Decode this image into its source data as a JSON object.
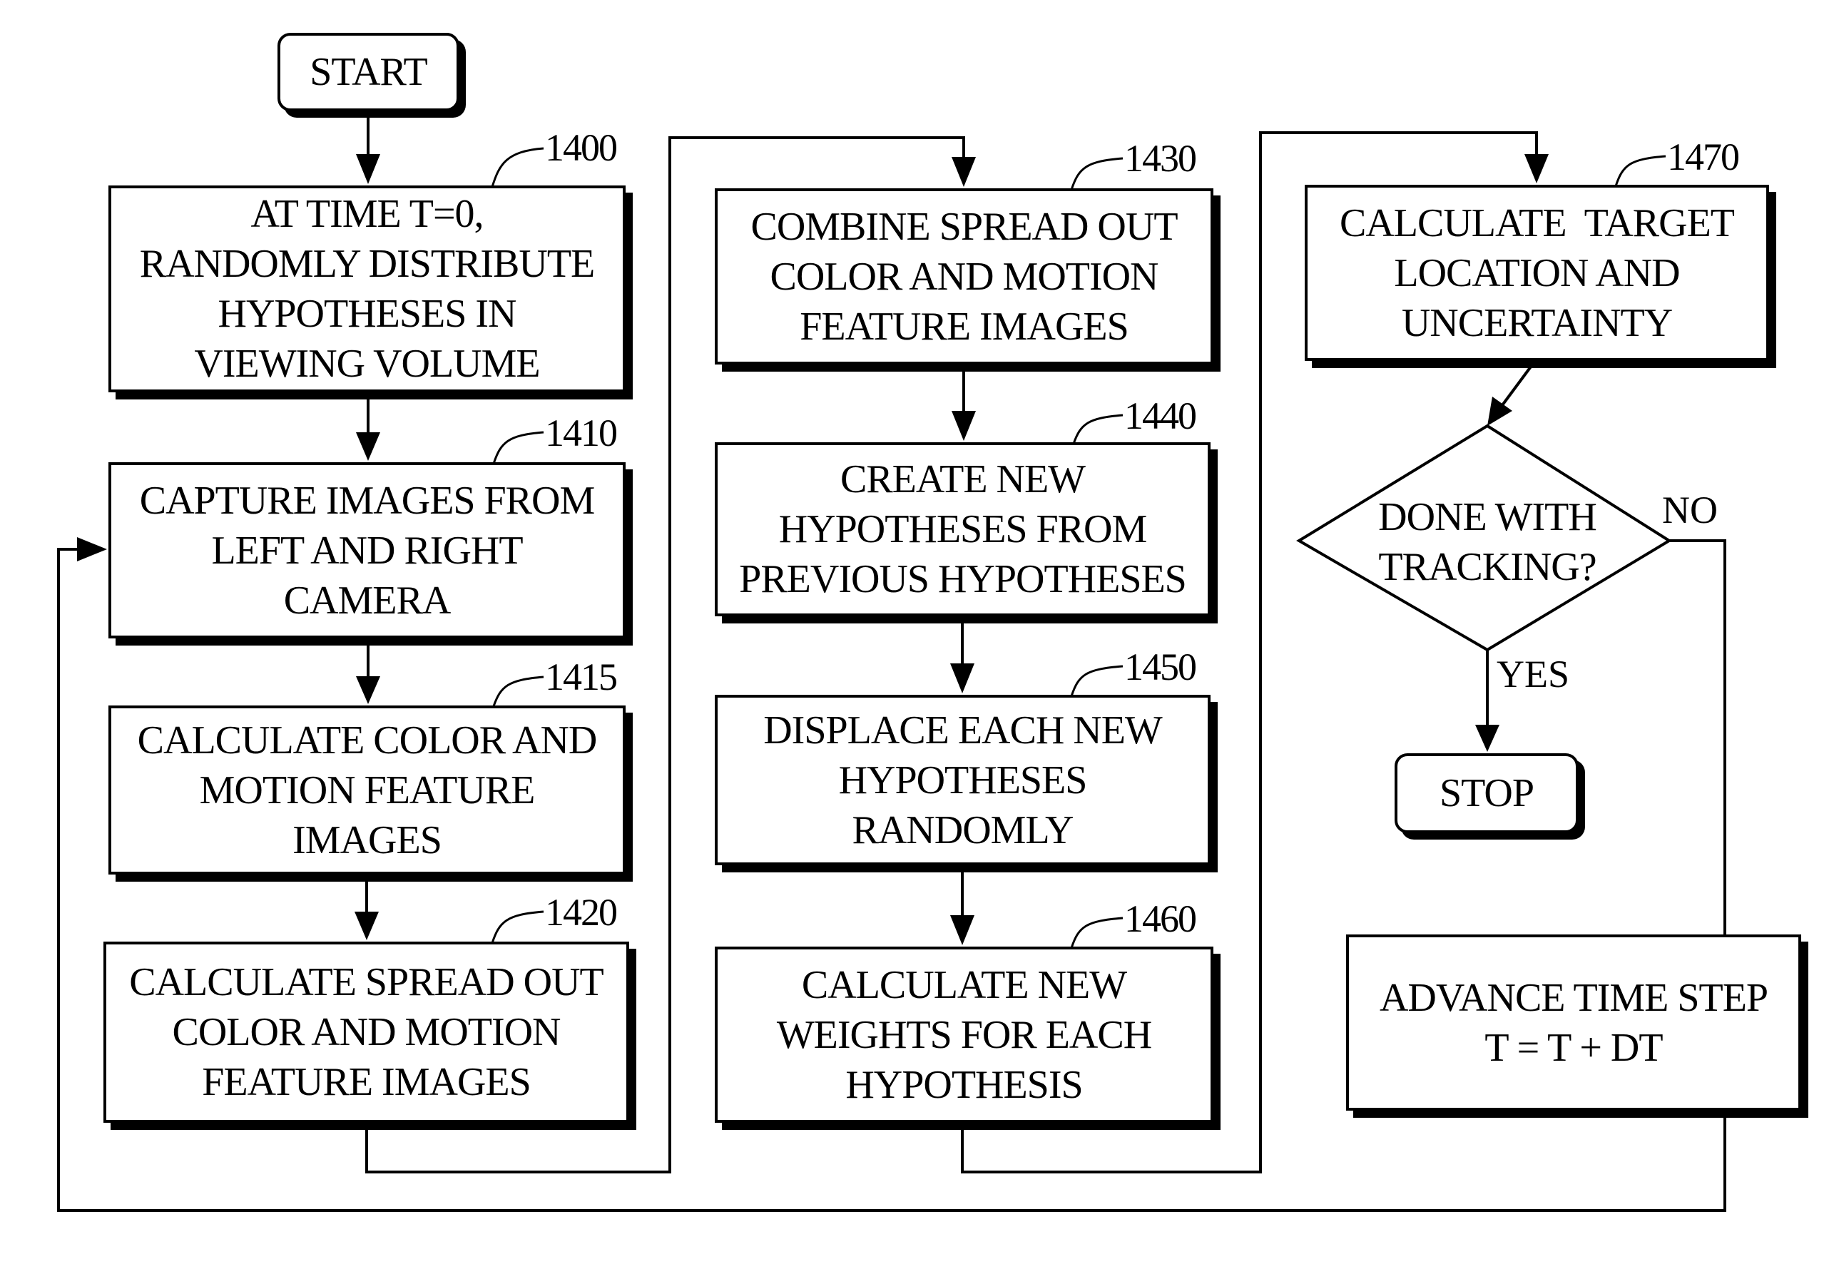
{
  "diagram": {
    "type": "flowchart",
    "start": {
      "label": "START"
    },
    "stop": {
      "label": "STOP"
    },
    "steps": [
      {
        "id": "1400",
        "lines": [
          "AT TIME T=0,",
          "RANDOMLY DISTRIBUTE",
          "HYPOTHESES IN",
          "VIEWING VOLUME"
        ]
      },
      {
        "id": "1410",
        "lines": [
          "CAPTURE IMAGES FROM",
          "LEFT AND RIGHT",
          "CAMERA"
        ]
      },
      {
        "id": "1415",
        "lines": [
          "CALCULATE COLOR AND",
          "MOTION FEATURE",
          "IMAGES"
        ]
      },
      {
        "id": "1420",
        "lines": [
          "CALCULATE SPREAD OUT",
          "COLOR AND MOTION",
          "FEATURE IMAGES"
        ]
      },
      {
        "id": "1430",
        "lines": [
          "COMBINE SPREAD OUT",
          "COLOR AND MOTION",
          "FEATURE IMAGES"
        ]
      },
      {
        "id": "1440",
        "lines": [
          "CREATE NEW",
          "HYPOTHESES FROM",
          "PREVIOUS HYPOTHESES"
        ]
      },
      {
        "id": "1450",
        "lines": [
          "DISPLACE EACH NEW",
          "HYPOTHESES",
          "RANDOMLY"
        ]
      },
      {
        "id": "1460",
        "lines": [
          "CALCULATE NEW",
          "WEIGHTS FOR EACH",
          "HYPOTHESIS"
        ]
      },
      {
        "id": "1470",
        "lines": [
          "CALCULATE  TARGET",
          "LOCATION AND",
          "UNCERTAINTY"
        ]
      }
    ],
    "decision": {
      "lines": [
        "DONE WITH",
        "TRACKING?"
      ],
      "yes_label": "YES",
      "no_label": "NO"
    },
    "advance": {
      "lines": [
        "ADVANCE TIME STEP",
        "T = T + DT"
      ]
    },
    "edges": [
      [
        "START",
        "1400"
      ],
      [
        "1400",
        "1410"
      ],
      [
        "1410",
        "1415"
      ],
      [
        "1415",
        "1420"
      ],
      [
        "1420",
        "1430"
      ],
      [
        "1430",
        "1440"
      ],
      [
        "1440",
        "1450"
      ],
      [
        "1450",
        "1460"
      ],
      [
        "1460",
        "1470"
      ],
      [
        "1470",
        "DECISION"
      ],
      [
        "DECISION:YES",
        "STOP"
      ],
      [
        "DECISION:NO",
        "ADVANCE"
      ],
      [
        "ADVANCE",
        "1410"
      ]
    ]
  }
}
